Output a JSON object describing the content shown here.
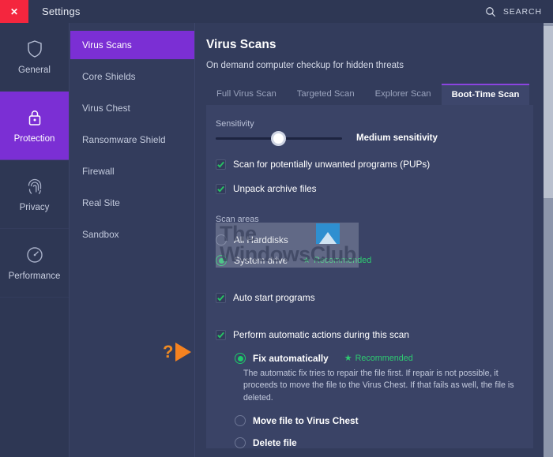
{
  "titlebar": {
    "close_label": "✕",
    "app_title": "Settings",
    "search_label": "SEARCH",
    "search_icon": "search-icon"
  },
  "sidebar": {
    "items": [
      {
        "label": "General",
        "icon": "shield-icon",
        "active": false
      },
      {
        "label": "Protection",
        "icon": "lock-icon",
        "active": true
      },
      {
        "label": "Privacy",
        "icon": "fingerprint-icon",
        "active": false
      },
      {
        "label": "Performance",
        "icon": "gauge-icon",
        "active": false
      }
    ],
    "active_color": "#7b2fd4"
  },
  "menu": {
    "items": [
      {
        "label": "Virus Scans",
        "active": true
      },
      {
        "label": "Core Shields",
        "active": false
      },
      {
        "label": "Virus Chest",
        "active": false
      },
      {
        "label": "Ransomware Shield",
        "active": false
      },
      {
        "label": "Firewall",
        "active": false
      },
      {
        "label": "Real Site",
        "active": false
      },
      {
        "label": "Sandbox",
        "active": false
      }
    ]
  },
  "main": {
    "title": "Virus Scans",
    "subtitle": "On demand computer checkup for hidden threats",
    "tabs": [
      {
        "label": "Full Virus Scan",
        "active": false
      },
      {
        "label": "Targeted Scan",
        "active": false
      },
      {
        "label": "Explorer Scan",
        "active": false
      },
      {
        "label": "Boot-Time Scan",
        "active": true
      }
    ],
    "sensitivity": {
      "label": "Sensitivity",
      "value_label": "Medium sensitivity",
      "position_percent": 44
    },
    "checkboxes": [
      {
        "label": "Scan for potentially unwanted programs (PUPs)",
        "checked": true
      },
      {
        "label": "Unpack archive files",
        "checked": true
      }
    ],
    "scan_areas": {
      "label": "Scan areas",
      "options": [
        {
          "label": "All Harddisks",
          "selected": false,
          "recommended": false
        },
        {
          "label": "System drive",
          "selected": true,
          "recommended": true
        }
      ],
      "recommended_label": "Recommended"
    },
    "auto_start": {
      "label": "Auto start programs",
      "checked": true
    },
    "automatic_actions": {
      "label": "Perform automatic actions during this scan",
      "checked": true,
      "options": [
        {
          "label": "Fix automatically",
          "selected": true,
          "recommended": true,
          "description": "The automatic fix tries to repair the file first. If repair is not possible, it proceeds to move the file to the Virus Chest. If that fails as well, the file is deleted."
        },
        {
          "label": "Move file to Virus Chest",
          "selected": false,
          "recommended": false,
          "description": ""
        },
        {
          "label": "Delete file",
          "selected": false,
          "recommended": false,
          "description": ""
        }
      ],
      "recommended_label": "Recommended"
    }
  },
  "watermark": {
    "line1": "The",
    "line2": "WindowsClub"
  },
  "annotation": {
    "marker": "?",
    "arrow": "arrow-right-icon",
    "color": "#f58220"
  },
  "scrollbar": {
    "thumb_position_percent": 1
  }
}
